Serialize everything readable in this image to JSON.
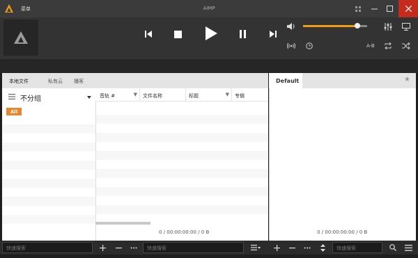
{
  "window": {
    "menu_label": "菜单",
    "title": "AIMP",
    "mini_icon": "grid-icon",
    "minimize_icon": "minimize-icon",
    "maximize_icon": "maximize-icon",
    "close_icon": "close-icon"
  },
  "player": {
    "volume_fraction": 0.85,
    "accent_color": "#f39c12",
    "ab_label": "A-B",
    "controls": [
      "previous-icon",
      "stop-icon",
      "play-icon",
      "pause-icon",
      "next-icon"
    ]
  },
  "library": {
    "tabs": [
      "本地文件",
      "私有云",
      "播客"
    ],
    "group_title": "不分组",
    "all_badge": "All"
  },
  "tracklist": {
    "columns": [
      "音轨 #",
      "文件名称",
      "标题",
      "专辑"
    ],
    "stats": "0 / 00:00:00:00 / 0 B"
  },
  "playlist": {
    "tab_label": "Default",
    "stats": "0 / 00:00:00:00 / 0 B"
  },
  "bottom": {
    "search1_placeholder": "快速搜索",
    "search2_placeholder": "快速搜索",
    "search3_placeholder": "快速搜索"
  }
}
